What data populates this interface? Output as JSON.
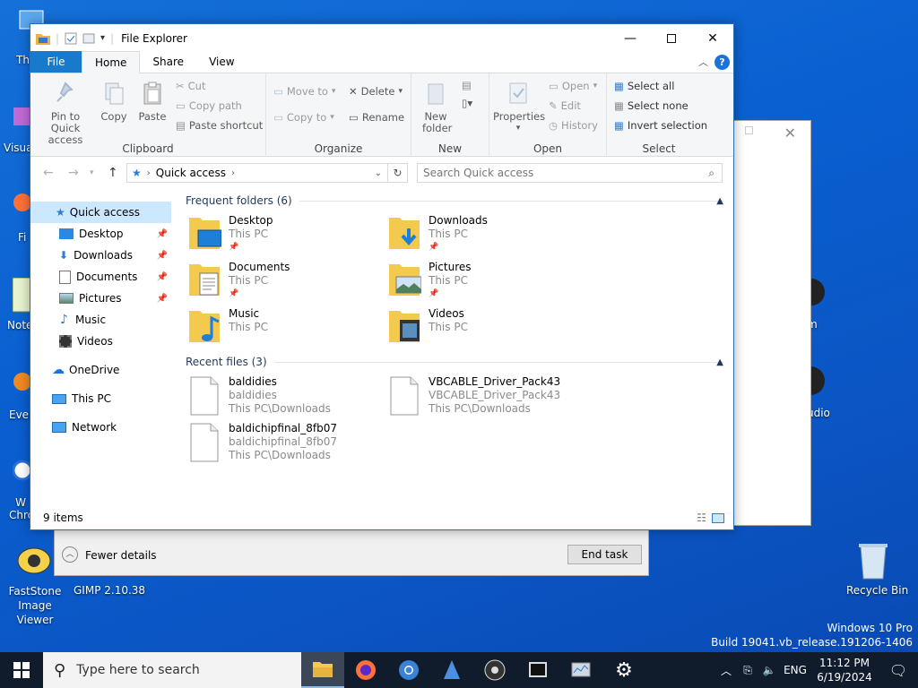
{
  "desktop": {
    "icons": [
      {
        "name": "this-pc-desktop-icon",
        "label": "Th"
      },
      {
        "name": "visual-studio-desktop-icon",
        "label": "Visua"
      },
      {
        "name": "firefox-desktop-icon",
        "label": "Fi"
      },
      {
        "name": "notepad-desktop-icon",
        "label": "Note"
      },
      {
        "name": "everything-desktop-icon",
        "label": "Ever"
      },
      {
        "name": "chrome-desktop-icon",
        "label": "W Chro"
      },
      {
        "name": "faststone-desktop-icon",
        "label": "FastStone Image Viewer"
      },
      {
        "name": "gimp-desktop-icon",
        "label": "GIMP 2.10.38"
      },
      {
        "name": "recycle-bin-desktop-icon",
        "label": "Recycle Bin"
      },
      {
        "name": "obs-desktop-icon",
        "label": "m"
      },
      {
        "name": "audio-desktop-icon",
        "label": "udio"
      }
    ],
    "watermark": {
      "line1": "Windows 10 Pro",
      "line2": "Build 19041.vb_release.191206-1406"
    }
  },
  "task_manager": {
    "fewer_details": "Fewer details",
    "end_task": "End task"
  },
  "explorer": {
    "title": "File Explorer",
    "tabs": {
      "file": "File",
      "home": "Home",
      "share": "Share",
      "view": "View"
    },
    "ribbon": {
      "clipboard": {
        "label": "Clipboard",
        "pin": "Pin to Quick access",
        "copy": "Copy",
        "paste": "Paste",
        "cut": "Cut",
        "copy_path": "Copy path",
        "paste_shortcut": "Paste shortcut"
      },
      "organize": {
        "label": "Organize",
        "move_to": "Move to",
        "copy_to": "Copy to",
        "delete": "Delete",
        "rename": "Rename"
      },
      "new": {
        "label": "New",
        "new_folder": "New folder"
      },
      "open": {
        "label": "Open",
        "properties": "Properties",
        "open": "Open",
        "edit": "Edit",
        "history": "History"
      },
      "select": {
        "label": "Select",
        "select_all": "Select all",
        "select_none": "Select none",
        "invert": "Invert selection"
      }
    },
    "address": {
      "path": "Quick access",
      "search_placeholder": "Search Quick access"
    },
    "nav": {
      "quick_access": "Quick access",
      "desktop": "Desktop",
      "downloads": "Downloads",
      "documents": "Documents",
      "pictures": "Pictures",
      "music": "Music",
      "videos": "Videos",
      "onedrive": "OneDrive",
      "this_pc": "This PC",
      "network": "Network"
    },
    "frequent": {
      "header": "Frequent folders (6)",
      "items": [
        {
          "name": "Desktop",
          "loc": "This PC"
        },
        {
          "name": "Downloads",
          "loc": "This PC"
        },
        {
          "name": "Documents",
          "loc": "This PC"
        },
        {
          "name": "Pictures",
          "loc": "This PC"
        },
        {
          "name": "Music",
          "loc": "This PC"
        },
        {
          "name": "Videos",
          "loc": "This PC"
        }
      ]
    },
    "recent": {
      "header": "Recent files (3)",
      "items": [
        {
          "name": "baldidies",
          "sub": "baldidies",
          "path": "This PC\\Downloads"
        },
        {
          "name": "VBCABLE_Driver_Pack43",
          "sub": "VBCABLE_Driver_Pack43",
          "path": "This PC\\Downloads"
        },
        {
          "name": "baldichipfinal_8fb07",
          "sub": "baldichipfinal_8fb07",
          "path": "This PC\\Downloads"
        }
      ]
    },
    "status": "9 items"
  },
  "taskbar": {
    "search_placeholder": "Type here to search",
    "lang": "ENG",
    "time": "11:12 PM",
    "date": "6/19/2024"
  }
}
